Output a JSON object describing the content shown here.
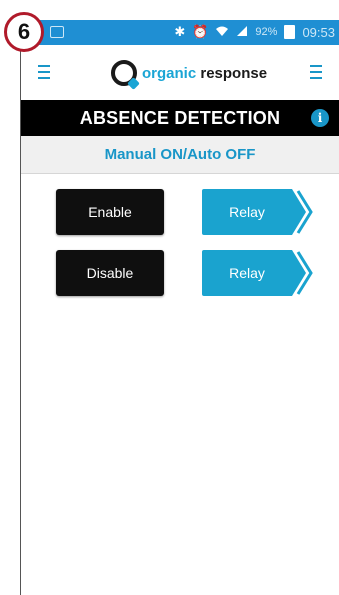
{
  "step_badge": "6",
  "statusbar": {
    "battery_percent": "92%",
    "time": "09:53",
    "icons": [
      "photo-icon",
      "bluetooth-icon",
      "alarm-icon",
      "wifi-icon",
      "signal-icon",
      "battery-icon"
    ]
  },
  "header": {
    "logo_brand": "organic",
    "logo_suffix": " response"
  },
  "titlebar": {
    "title": "ABSENCE DETECTION",
    "info_glyph": "i"
  },
  "mode": {
    "label": "Manual ON/Auto OFF"
  },
  "rows": [
    {
      "action_label": "Enable",
      "relay_label": "Relay"
    },
    {
      "action_label": "Disable",
      "relay_label": "Relay"
    }
  ],
  "colors": {
    "accent": "#1aa3cf",
    "statusbar": "#1f8fd3",
    "button_dark": "#0f0f0f",
    "badge_ring": "#b01a2a"
  }
}
